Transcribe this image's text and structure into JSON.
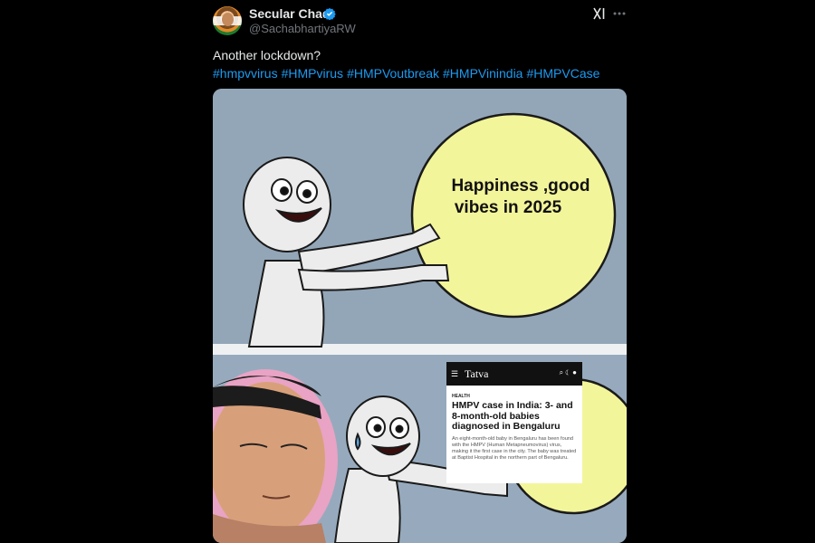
{
  "post": {
    "author": {
      "display_name": "Secular Chad",
      "handle": "@SachabhartiyaRW",
      "verified": true
    },
    "text": "Another lockdown?",
    "hashtags": [
      "#hmpvvirus",
      "#HMPvirus",
      "#HMPVoutbreak",
      "#HMPVinindia",
      "#HMPVCase"
    ],
    "accent_color": "#1d9bf0",
    "icons": [
      "verified-badge-icon",
      "grok-icon",
      "more-icon"
    ]
  },
  "meme": {
    "ball_text_line1": "Happiness ,good",
    "ball_text_line2": "vibes in 2025",
    "article": {
      "site": "Tatva",
      "category": "HEALTH",
      "headline": "HMPV case in India: 3- and 8-month-old babies diagnosed in Bengaluru",
      "summary": "An eight-month-old baby in Bengaluru has been found with the HMPV (Human Metapneumovirus) virus, making it the first case in the city. The baby was treated at Baptist Hospital in the northern part of Bengaluru."
    }
  }
}
